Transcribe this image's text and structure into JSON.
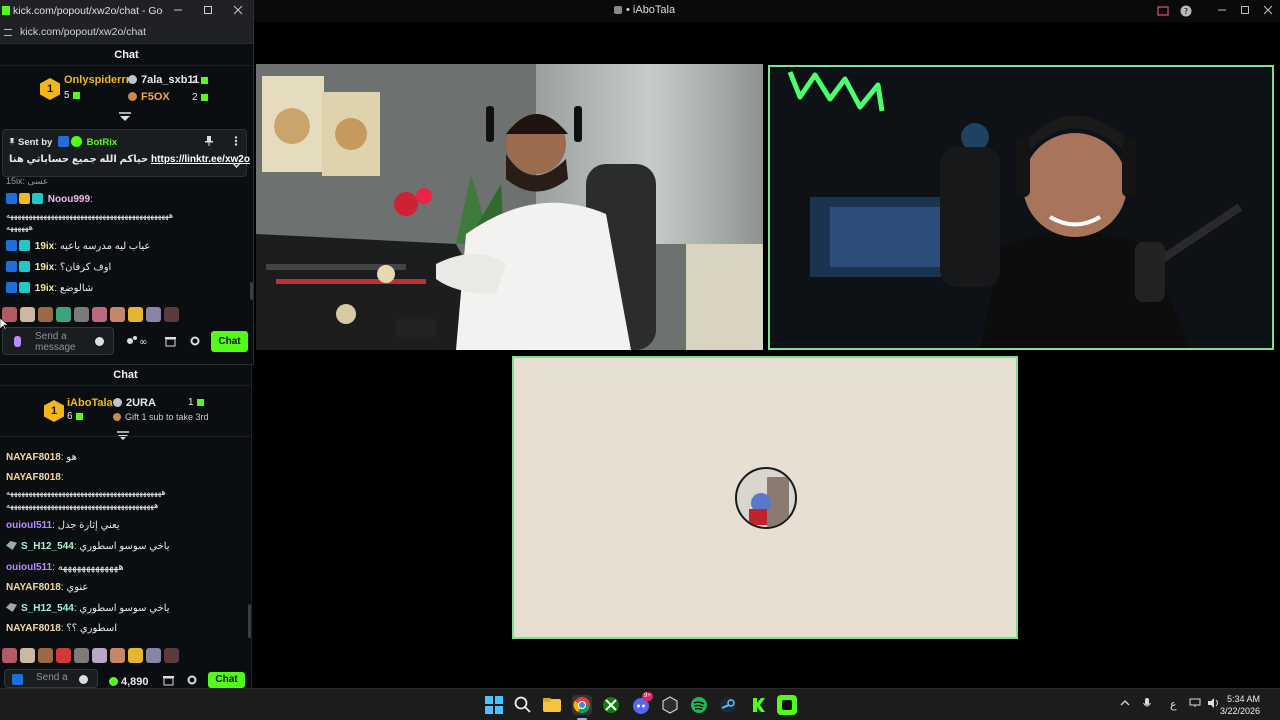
{
  "main_window": {
    "title": "• iAboTala"
  },
  "popout": {
    "window_title": "kick.com/popout/xw2o/chat - Google Ch...",
    "url": "kick.com/popout/xw2o/chat",
    "chat_header": "Chat",
    "leaderboard": {
      "first_name": "Onlyspiderrr",
      "first_count": "5",
      "second_name": "7ala_sxb11",
      "second_count": "2",
      "third_name": "F5OX",
      "third_count": "2",
      "rank": "1"
    },
    "pinned": {
      "sent_by_label": "Sent by",
      "sender": "BotRix",
      "message_text": "حياكم الله جميع حساباتي هنا",
      "link": "https://linktr.ee/xw2o"
    },
    "messages": [
      {
        "user": "",
        "text": "15ix: عسى"
      },
      {
        "user": "Noou999",
        "text": ":"
      },
      {
        "user": "",
        "text": "ههههههههههههههههههههههههههههههههههههههههههههه"
      },
      {
        "user": "",
        "text": "ههههههه"
      },
      {
        "user": "19ix",
        "text": "عياب ليه مدرسه ياعيه"
      },
      {
        "user": "19ix",
        "text": "اوف كرفان؟"
      },
      {
        "user": "19ix",
        "text": "شالوضع"
      }
    ],
    "input_placeholder_1": "Send a",
    "input_placeholder_2": "message",
    "chat_button": "Chat"
  },
  "lower_chat": {
    "chat_header": "Chat",
    "leaderboard": {
      "rank": "1",
      "first_name": "iAboTala",
      "first_count": "6",
      "second_name": "2URA",
      "second_count": "1",
      "hint": "Gift 1 sub to take 3rd"
    },
    "messages": [
      {
        "user": "NAYAF8018",
        "text": ": هو",
        "color": "#f3d9a6"
      },
      {
        "user": "NAYAF8018",
        "text": ":",
        "color": "#f3d9a6"
      },
      {
        "user": "",
        "text": "ههههههههههههههههههههههههههههههههههههههههههه",
        "color": "#e8e8e8"
      },
      {
        "user": "",
        "text": "ههههههههههههههههههههههههههههههههههههههههه",
        "color": "#e8e8e8"
      },
      {
        "user": "ouiouI511",
        "text": ": يعني إثارة جدل",
        "color": "#b48cff"
      },
      {
        "user": "S_H12_544",
        "text": ": ياخي سوسو اسطوري",
        "color": "#a7f3d0"
      },
      {
        "user": "ouiouI511",
        "text": ": هههههههههههههه",
        "color": "#b48cff"
      },
      {
        "user": "NAYAF8018",
        "text": ": عنوي",
        "color": "#f3d9a6"
      },
      {
        "user": "S_H12_544",
        "text": ": ياخي سوسو اسطوري",
        "color": "#a7f3d0"
      },
      {
        "user": "NAYAF8018",
        "text": ": اسطوري ؟؟",
        "color": "#f3d9a6"
      }
    ],
    "input_placeholder_1": "Send a",
    "input_placeholder_2": "message",
    "points": "4,890",
    "chat_button": "Chat"
  },
  "taskbar": {
    "discord_badge": "9+",
    "lang": "ع",
    "time": "5:34 AM",
    "date": "3/22/2026"
  },
  "colors": {
    "kick_green": "#53fc18",
    "tile_border": "#7fe08f",
    "gold": "#f2b81b"
  }
}
